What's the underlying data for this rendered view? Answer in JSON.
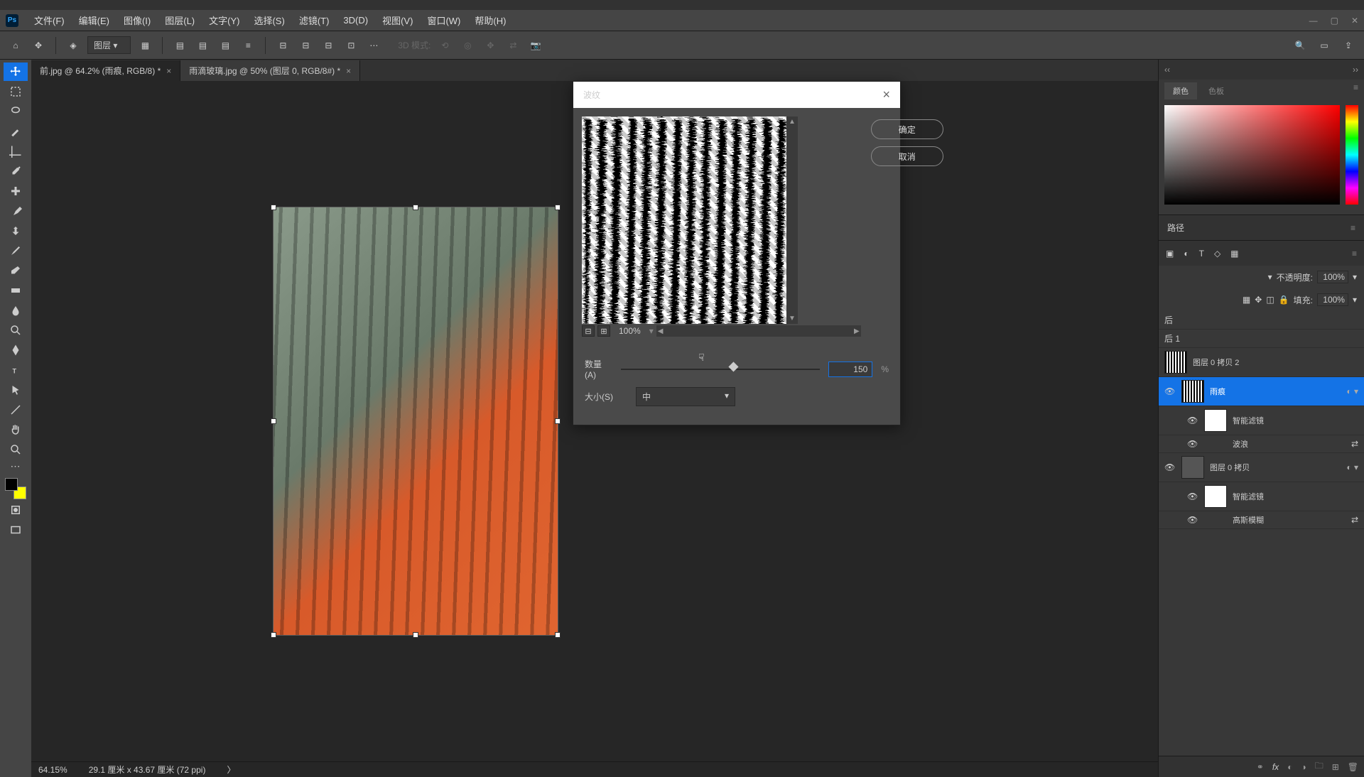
{
  "menu": {
    "file": "文件(F)",
    "edit": "编辑(E)",
    "image": "图像(I)",
    "layer": "图层(L)",
    "type": "文字(Y)",
    "select": "选择(S)",
    "filter": "滤镜(T)",
    "threed": "3D(D)",
    "view": "视图(V)",
    "window": "窗口(W)",
    "help": "帮助(H)"
  },
  "optbar": {
    "layer_select": "图层",
    "threed_mode": "3D 模式:"
  },
  "tabs": {
    "tab1": "前.jpg @ 64.2% (雨痕, RGB/8) *",
    "tab2": "雨滴玻璃.jpg @ 50% (图层 0, RGB/8#) *"
  },
  "dialog": {
    "title": "波纹",
    "ok": "确定",
    "cancel": "取消",
    "zoom": "100%",
    "amount_label": "数量(A)",
    "amount_value": "150",
    "amount_unit": "%",
    "size_label": "大小(S)",
    "size_value": "中"
  },
  "color": {
    "tab1": "颜色",
    "tab2": "色板"
  },
  "paths": {
    "label": "路径"
  },
  "props": {
    "opacity_label": "不透明度:",
    "opacity_value": "100%",
    "fill_label": "填充:",
    "fill_value": "100%",
    "after": "后",
    "after1": "后 1"
  },
  "layers": {
    "l1": "图层 0 拷贝 2",
    "l2": "雨痕",
    "l3": "智能滤镜",
    "l3b": "波浪",
    "l4": "图层 0 拷贝",
    "l5": "智能滤镜",
    "l5b": "高斯模糊"
  },
  "status": {
    "zoom": "64.15%",
    "dims": "29.1 厘米 x 43.67 厘米 (72 ppi)"
  }
}
